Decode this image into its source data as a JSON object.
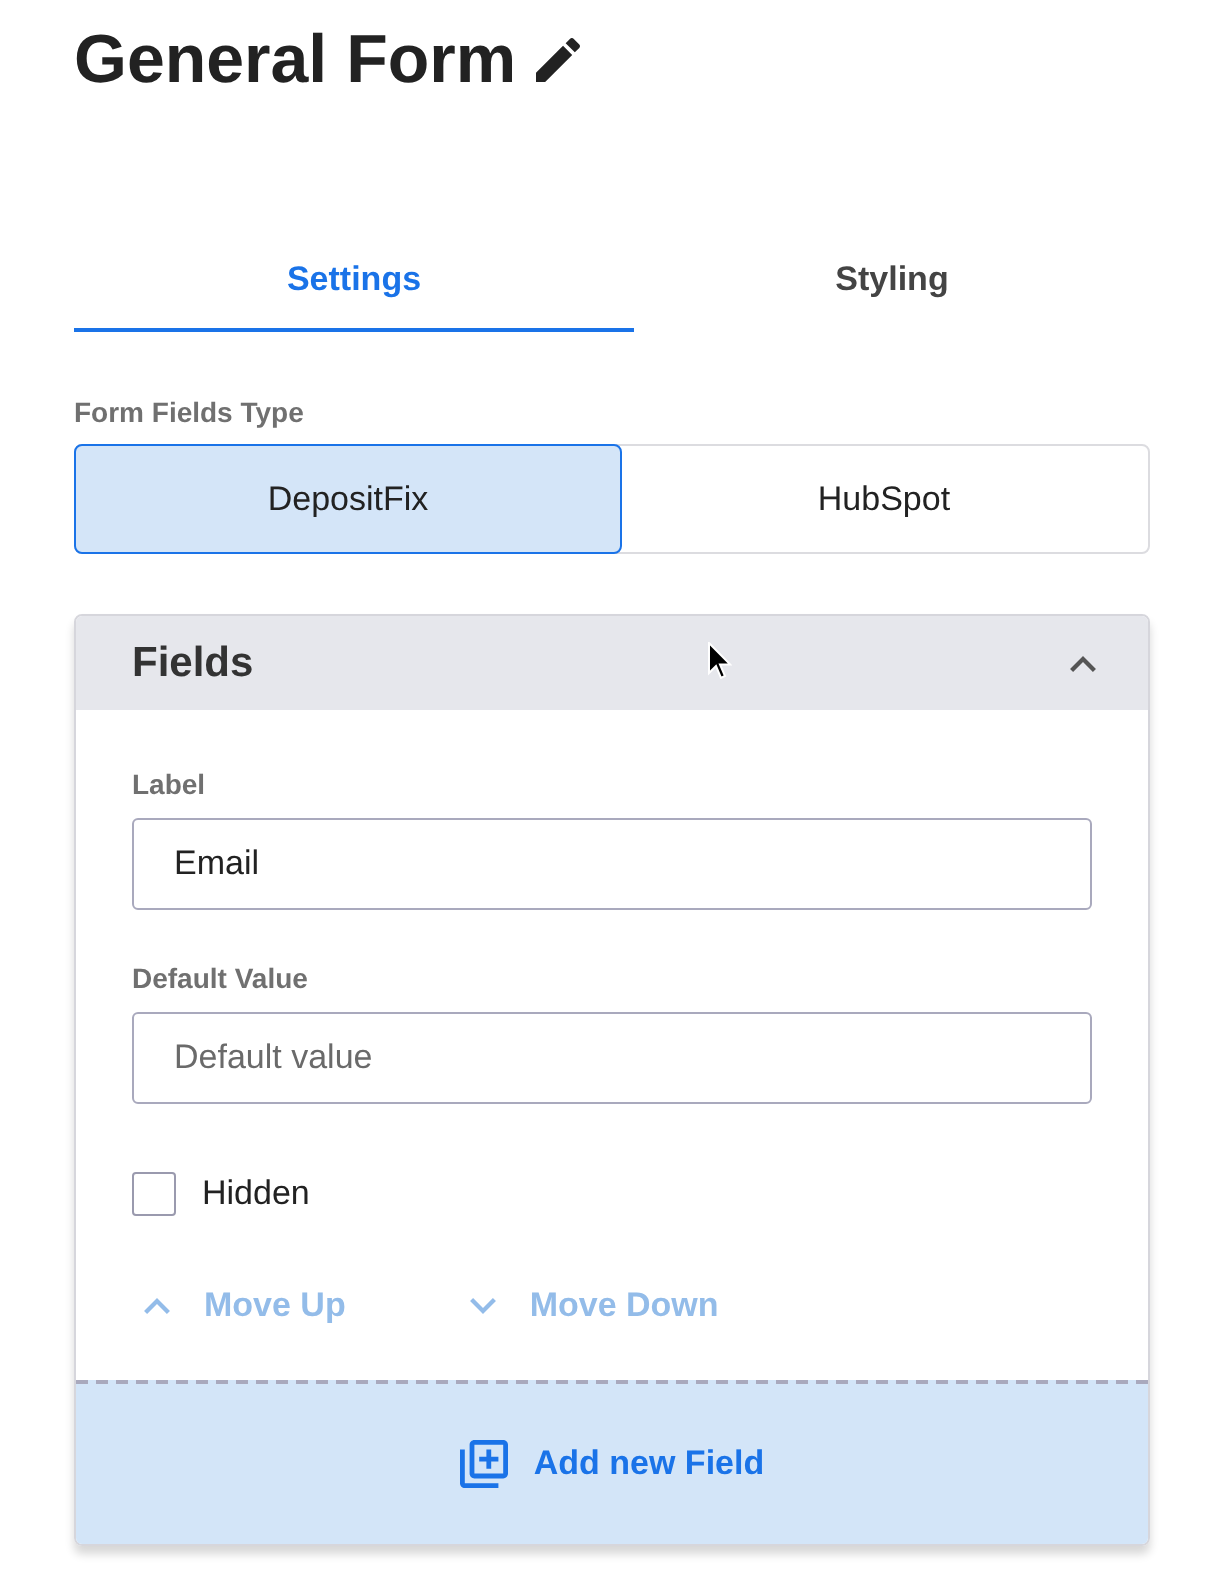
{
  "title": "General Form",
  "tabs": [
    {
      "label": "Settings",
      "selected": true
    },
    {
      "label": "Styling",
      "selected": false
    }
  ],
  "form_fields_type": {
    "label": "Form Fields Type",
    "options": [
      {
        "label": "DepositFix",
        "selected": true
      },
      {
        "label": "HubSpot",
        "selected": false
      }
    ]
  },
  "fields_panel": {
    "title": "Fields",
    "expanded": true,
    "inputs": [
      {
        "label": "Label",
        "value": "Email"
      },
      {
        "label": "Default Value",
        "placeholder": "Default value"
      }
    ],
    "checkbox": {
      "label": "Hidden",
      "checked": false
    },
    "actions": [
      {
        "label": "Move Up",
        "kind": "up",
        "disabled": true
      },
      {
        "label": "Move Down",
        "kind": "down",
        "disabled": true
      }
    ],
    "add_button": "Add new Field"
  }
}
